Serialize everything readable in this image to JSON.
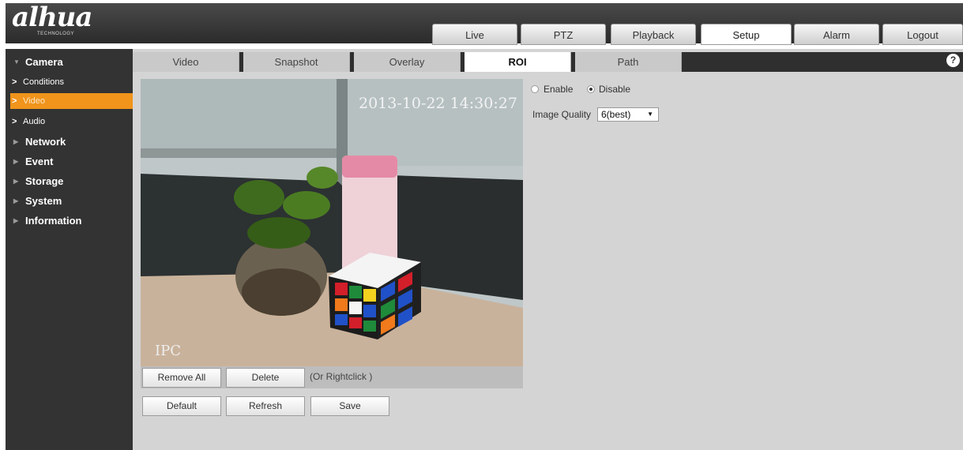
{
  "brand": {
    "name": "alhua",
    "tagline": "TECHNOLOGY"
  },
  "topnav": [
    "Live",
    "PTZ",
    "Playback",
    "Setup",
    "Alarm",
    "Logout"
  ],
  "sidebar": {
    "camera": "Camera",
    "sub": [
      "Conditions",
      "Video",
      "Audio"
    ],
    "items": [
      "Network",
      "Event",
      "Storage",
      "System",
      "Information"
    ]
  },
  "subtabs": [
    "Video",
    "Snapshot",
    "Overlay",
    "ROI",
    "Path"
  ],
  "help": "?",
  "video": {
    "timestamp": "2013-10-22 14:30:27",
    "channel_name": "IPC"
  },
  "buttons": {
    "remove_all": "Remove All",
    "delete": "Delete",
    "hint": "(Or Rightclick )",
    "default": "Default",
    "refresh": "Refresh",
    "save": "Save"
  },
  "roi": {
    "enable_label": "Enable",
    "disable_label": "Disable",
    "selected": "Disable",
    "quality_label": "Image Quality",
    "quality_value": "6(best)"
  },
  "colors": {
    "accent": "#f0941c",
    "sidebar_bg": "#333333",
    "content_bg": "#d4d4d4"
  }
}
